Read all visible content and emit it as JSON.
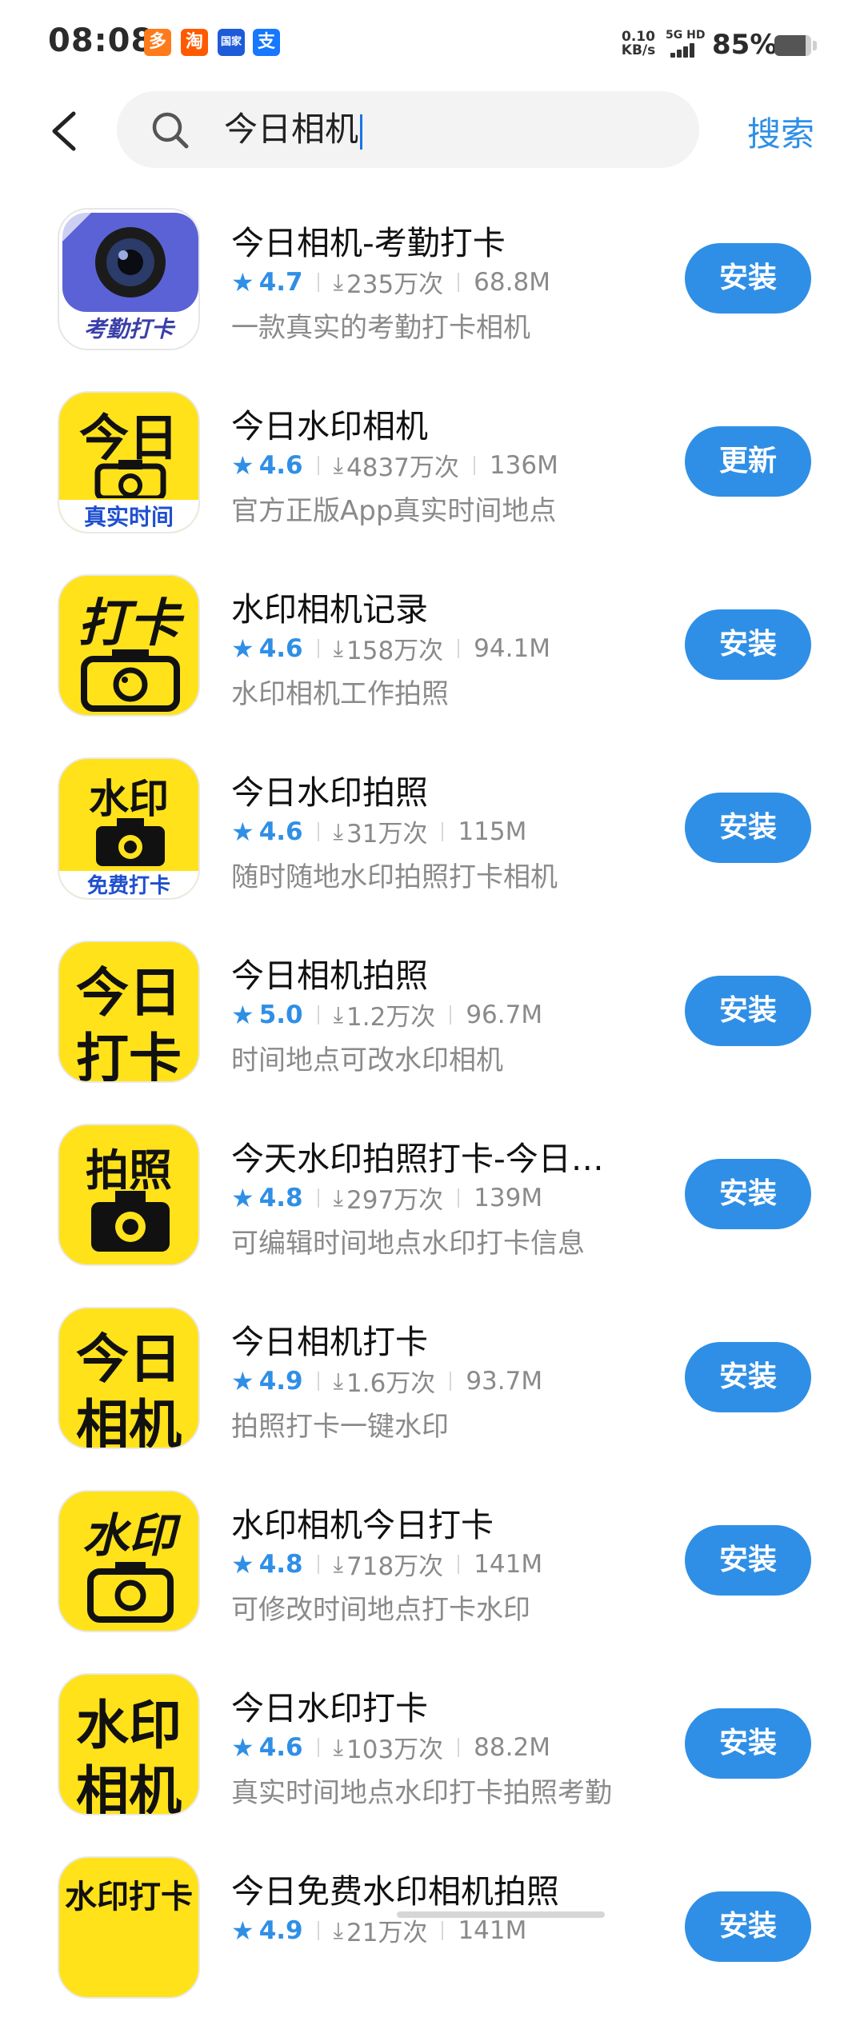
{
  "status_bar": {
    "time": "08:08",
    "net_speed_value": "0.10",
    "net_speed_unit": "KB/s",
    "network": "5G HD",
    "battery": "85%",
    "battery_level": 0.85
  },
  "search": {
    "query": "今日相机",
    "button_label": "搜索"
  },
  "apps": [
    {
      "title": "今日相机-考勤打卡",
      "rating": "4.7",
      "downloads": "235万次",
      "size": "68.8M",
      "desc": "一款真实的考勤打卡相机",
      "action": "安装",
      "icon_text": "考勤打卡"
    },
    {
      "title": "今日水印相机",
      "rating": "4.6",
      "downloads": "4837万次",
      "size": "136M",
      "desc": "官方正版App真实时间地点",
      "action": "更新",
      "icon_text": "今日",
      "icon_subtext": "真实时间"
    },
    {
      "title": "水印相机记录",
      "rating": "4.6",
      "downloads": "158万次",
      "size": "94.1M",
      "desc": "水印相机工作拍照",
      "action": "安装",
      "icon_text": "打卡"
    },
    {
      "title": "今日水印拍照",
      "rating": "4.6",
      "downloads": "31万次",
      "size": "115M",
      "desc": "随时随地水印拍照打卡相机",
      "action": "安装",
      "icon_text": "水印",
      "icon_subtext": "免费打卡"
    },
    {
      "title": "今日相机拍照",
      "rating": "5.0",
      "downloads": "1.2万次",
      "size": "96.7M",
      "desc": "时间地点可改水印相机",
      "action": "安装",
      "icon_text": "今日",
      "icon_text2": "打卡"
    },
    {
      "title": "今天水印拍照打卡-今日…",
      "rating": "4.8",
      "downloads": "297万次",
      "size": "139M",
      "desc": "可编辑时间地点水印打卡信息",
      "action": "安装",
      "icon_text": "拍照"
    },
    {
      "title": "今日相机打卡",
      "rating": "4.9",
      "downloads": "1.6万次",
      "size": "93.7M",
      "desc": "拍照打卡一键水印",
      "action": "安装",
      "icon_text": "今日",
      "icon_text2": "相机"
    },
    {
      "title": "水印相机今日打卡",
      "rating": "4.8",
      "downloads": "718万次",
      "size": "141M",
      "desc": "可修改时间地点打卡水印",
      "action": "安装",
      "icon_text": "水印"
    },
    {
      "title": "今日水印打卡",
      "rating": "4.6",
      "downloads": "103万次",
      "size": "88.2M",
      "desc": "真实时间地点水印打卡拍照考勤",
      "action": "安装",
      "icon_text": "水印",
      "icon_text2": "相机"
    },
    {
      "title": "今日免费水印相机拍照",
      "rating": "4.9",
      "downloads": "21万次",
      "size": "141M",
      "desc": "",
      "action": "安装",
      "icon_text": "水印打卡"
    }
  ]
}
